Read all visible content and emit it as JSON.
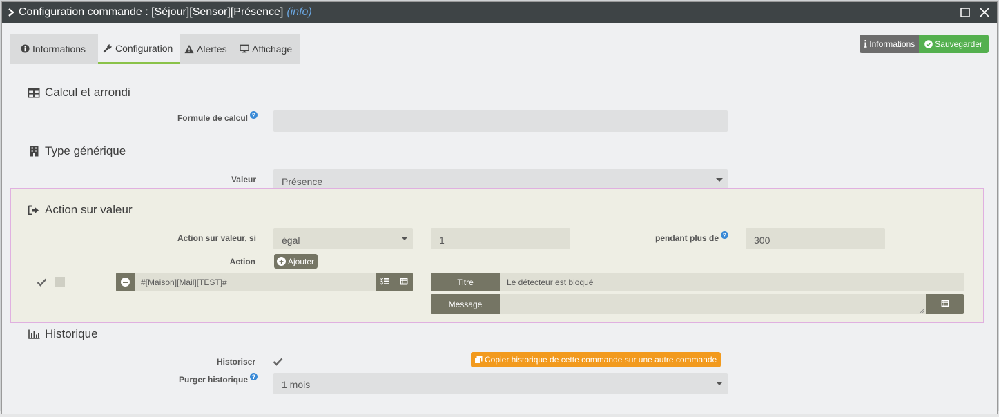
{
  "window": {
    "title": "Configuration commande : [Séjour][Sensor][Présence]",
    "title_suffix": "(info)"
  },
  "tabs": [
    {
      "label": "Informations",
      "icon": "info-circle-icon",
      "active": false
    },
    {
      "label": "Configuration",
      "icon": "wrench-icon",
      "active": true
    },
    {
      "label": "Alertes",
      "icon": "warning-icon",
      "active": false
    },
    {
      "label": "Affichage",
      "icon": "desktop-icon",
      "active": false
    }
  ],
  "toolbar": {
    "info_label": "Informations",
    "save_label": "Sauvegarder"
  },
  "calcul": {
    "title": "Calcul et arrondi",
    "formula_label": "Formule de calcul",
    "formula_value": ""
  },
  "generic": {
    "title": "Type générique",
    "value_label": "Valeur",
    "value_selected": "Présence"
  },
  "action": {
    "title": "Action sur valeur",
    "condition_label": "Action sur valeur, si",
    "operator": "égal",
    "value": "1",
    "duration_label": "pendant plus de",
    "duration": "300",
    "action_label": "Action",
    "add_label": "Ajouter",
    "command": "#[Maison][Mail][TEST]#",
    "titre_label": "Titre",
    "titre_value": "Le détecteur est bloqué",
    "message_label": "Message",
    "message_value": ""
  },
  "history": {
    "title": "Historique",
    "historiser_label": "Historiser",
    "copy_label": "Copier historique de cette commande sur une autre commande",
    "purge_label": "Purger historique",
    "purge_selected": "1 mois"
  },
  "colors": {
    "titlebar": "#3e4446",
    "accent_green": "#54b04f",
    "action_button": "#757564",
    "copy_button": "#f29a1e",
    "help_blue": "#3a8ad6"
  }
}
